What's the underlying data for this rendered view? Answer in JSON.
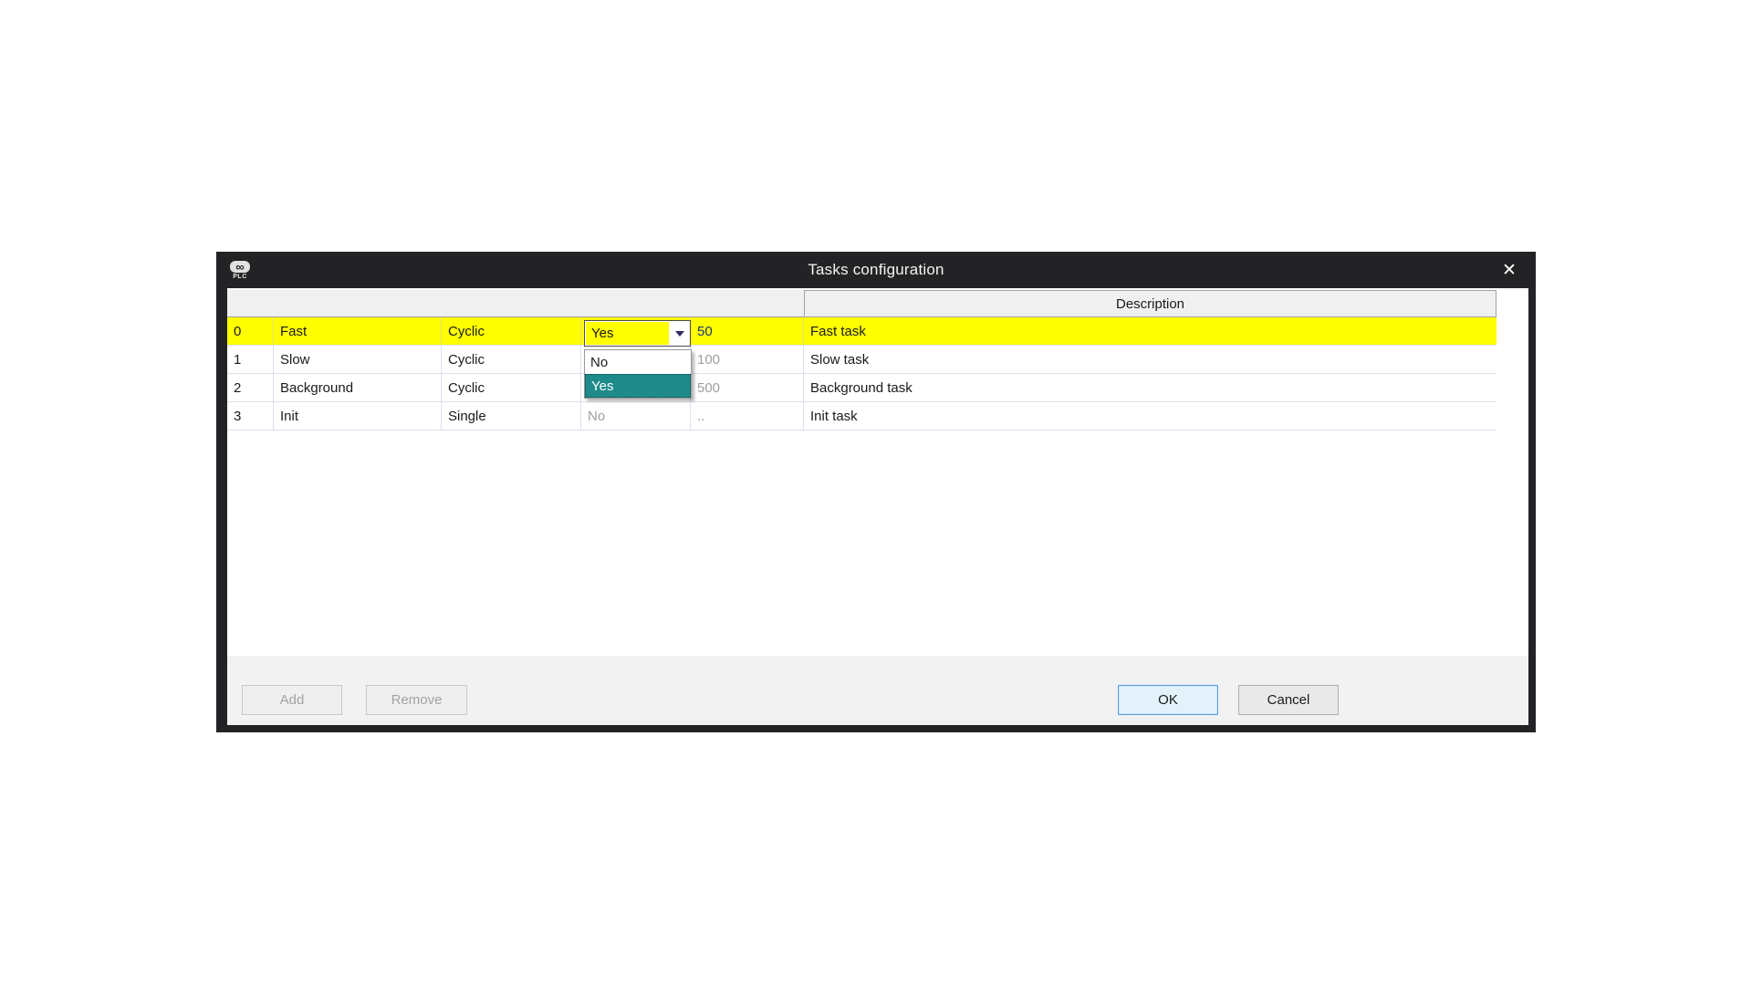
{
  "dialog": {
    "title": "Tasks configuration",
    "app_icon": {
      "infinity_glyph": "∞",
      "plc_label": "PLC"
    },
    "close_glyph": "✕"
  },
  "table": {
    "header": {
      "description_label": "Description"
    },
    "rows": [
      {
        "id": "0",
        "name": "Fast",
        "type": "Cyclic",
        "single": "Yes",
        "interval": "50",
        "description": "Fast task",
        "highlighted": true
      },
      {
        "id": "1",
        "name": "Slow",
        "type": "Cyclic",
        "single": "",
        "interval": "100",
        "description": "Slow task",
        "highlighted": false
      },
      {
        "id": "2",
        "name": "Background",
        "type": "Cyclic",
        "single": "",
        "interval": "500",
        "description": "Background task",
        "highlighted": false
      },
      {
        "id": "3",
        "name": "Init",
        "type": "Single",
        "single": "No",
        "interval": "..",
        "description": "Init task",
        "highlighted": false
      }
    ]
  },
  "dropdown": {
    "value": "Yes",
    "options": [
      "No",
      "Yes"
    ],
    "selected_option": "Yes"
  },
  "buttons": {
    "add": "Add",
    "remove": "Remove",
    "ok": "OK",
    "cancel": "Cancel"
  },
  "colors": {
    "titlebar": "#232326",
    "row_highlight": "#ffff00",
    "dropdown_selection": "#1f8a8a",
    "interval_active_text": "#1b3870",
    "muted_text": "#9e9e9e",
    "ok_border": "#569de0"
  }
}
